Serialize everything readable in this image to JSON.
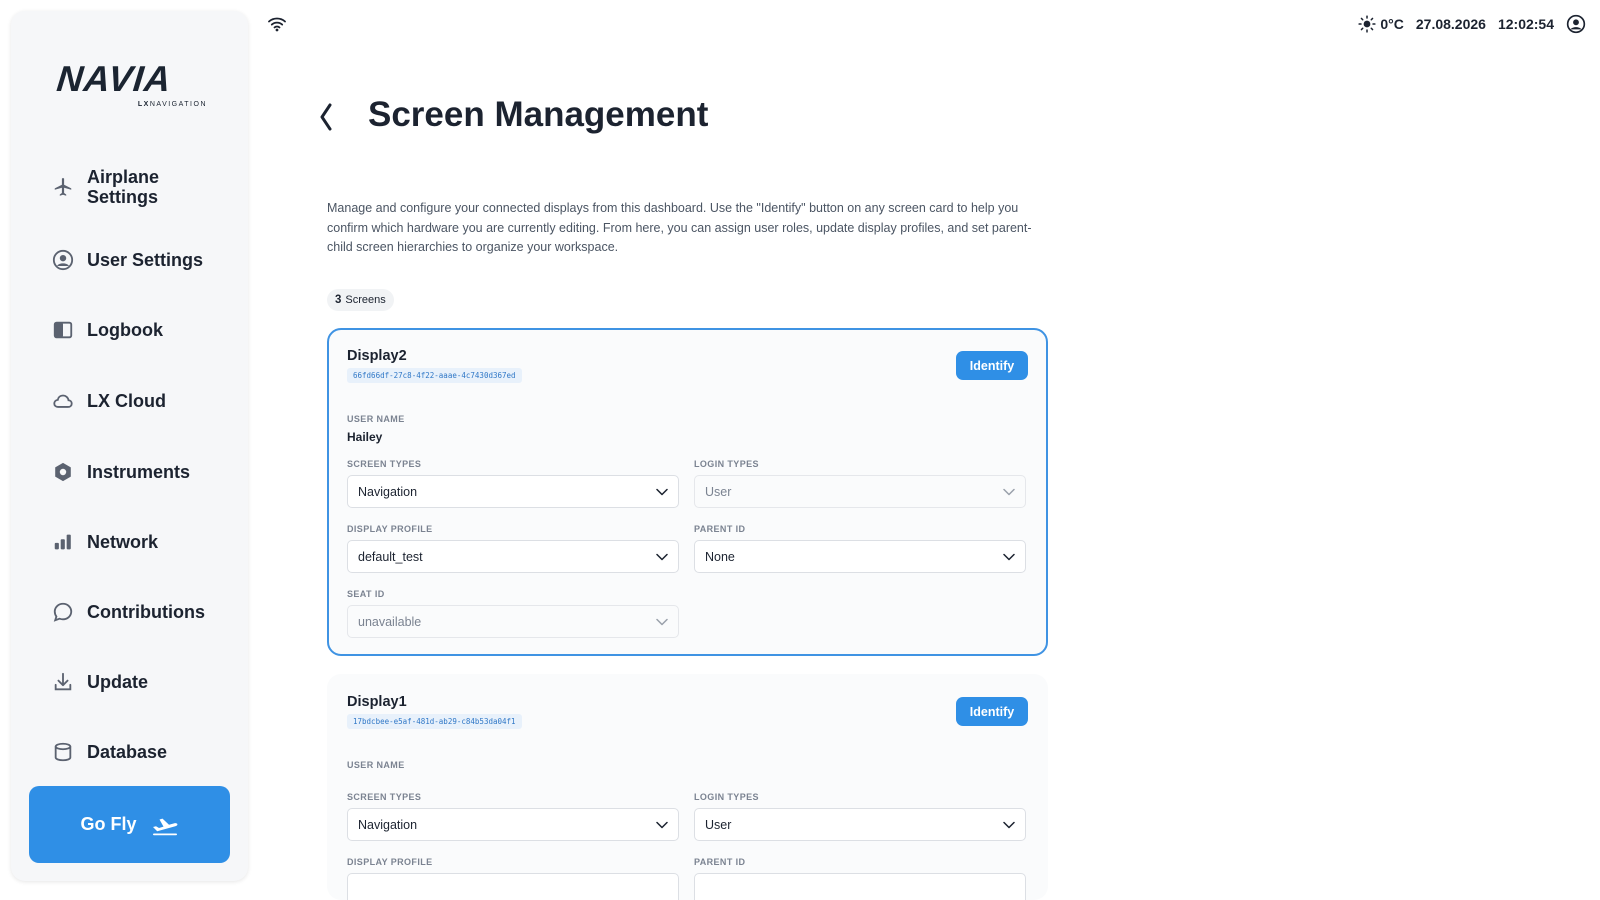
{
  "logo": {
    "wordmark": "NAVIA",
    "sub_bold": "LX",
    "sub_rest": "NAVIGATION"
  },
  "sidebar": {
    "items": [
      {
        "label": "Airplane\nSettings",
        "icon": "airplane-icon"
      },
      {
        "label": "User Settings",
        "icon": "user-circle-icon"
      },
      {
        "label": "Logbook",
        "icon": "logbook-icon"
      },
      {
        "label": "LX Cloud",
        "icon": "cloud-icon"
      },
      {
        "label": "Instruments",
        "icon": "hexagon-icon"
      },
      {
        "label": "Network",
        "icon": "signal-bars-icon"
      },
      {
        "label": "Contributions",
        "icon": "chat-bubble-icon"
      },
      {
        "label": "Update",
        "icon": "download-icon"
      },
      {
        "label": "Database",
        "icon": "database-icon"
      }
    ],
    "go_fly": {
      "label": "Go Fly",
      "icon": "airplane-takeoff-icon"
    }
  },
  "topbar": {
    "wifi_icon": "wifi-icon",
    "weather_icon": "sun-icon",
    "temperature": "0°C",
    "date": "27.08.2026",
    "time": "12:02:54",
    "account_icon": "account-circle-icon"
  },
  "page": {
    "title": "Screen Management",
    "description": "Manage and configure your connected displays from this dashboard. Use the \"Identify\" button on any screen card to help you confirm which hardware you are currently editing. From here, you can assign user roles, update display profiles, and set parent-child screen hierarchies to organize your workspace.",
    "screen_count": "3",
    "screen_count_label": "Screens"
  },
  "labels": {
    "identify": "Identify",
    "user_name": "USER NAME",
    "screen_types": "SCREEN TYPES",
    "login_types": "LOGIN TYPES",
    "display_profile": "DISPLAY PROFILE",
    "parent_id": "PARENT ID",
    "seat_id": "SEAT ID"
  },
  "screens": [
    {
      "name": "Display2",
      "id": "66fd66df-27c8-4f22-aaae-4c7430d367ed",
      "user_name": "Hailey",
      "screen_type": "Navigation",
      "login_type": "User",
      "display_profile": "default_test",
      "parent_id": "None",
      "seat_id": "unavailable"
    },
    {
      "name": "Display1",
      "id": "17bdcbee-e5af-481d-ab29-c84b53da04f1",
      "user_name": "",
      "screen_type": "Navigation",
      "login_type": "User"
    }
  ],
  "colors": {
    "accent": "#2f8fe6",
    "selected_border": "#3f93e3",
    "text": "#1c2330",
    "muted": "#7b8391"
  }
}
